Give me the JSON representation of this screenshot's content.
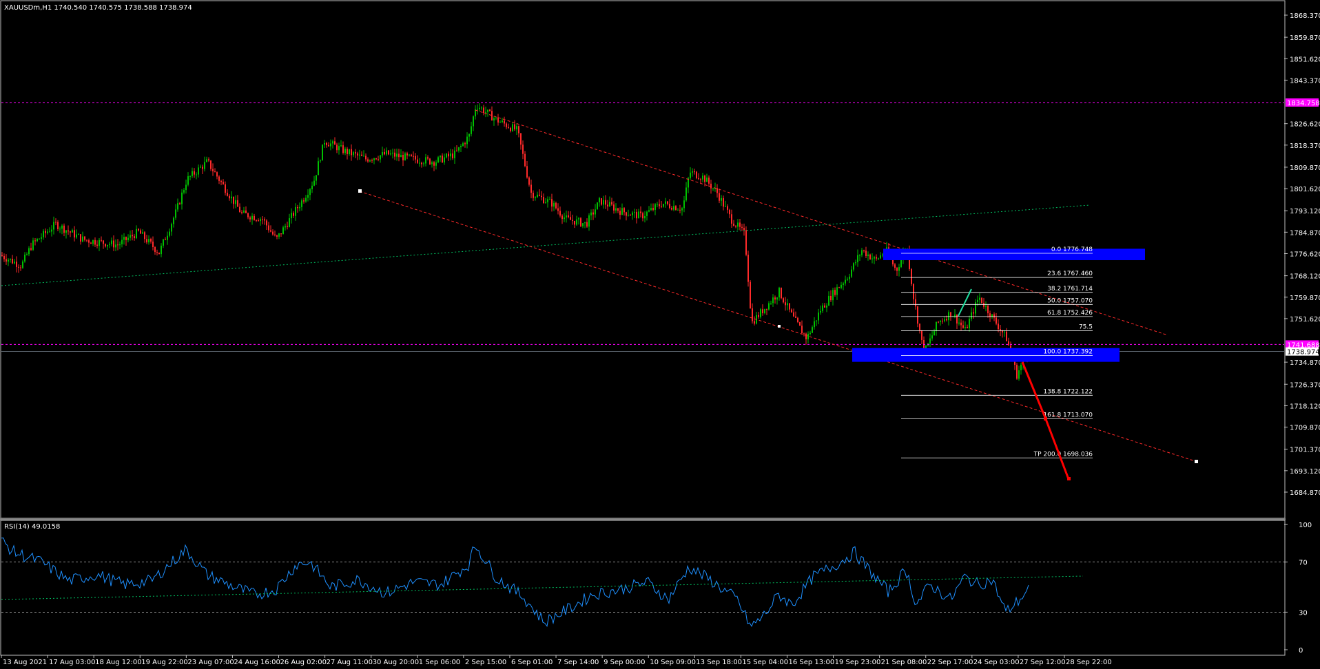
{
  "header": {
    "symbol_line": "XAUUSDm,H1  1740.540 1740.575 1738.588 1738.974",
    "rsi_line": "RSI(14) 49.0158"
  },
  "colors": {
    "bg": "#000000",
    "frame": "#c0c0c0",
    "bull": "#00c000",
    "bear": "#ff2a2a",
    "magenta": "#ff00ff",
    "channel": "#ff2a2a",
    "trend": "#00c060",
    "blue_zone": "#0000ff",
    "rsi": "#1e90ff",
    "text": "#ffffff"
  },
  "price_axis": {
    "labels": [
      "1868.370",
      "1859.870",
      "1851.620",
      "1843.370",
      "1826.620",
      "1818.370",
      "1809.870",
      "1801.620",
      "1793.120",
      "1784.870",
      "1776.620",
      "1768.120",
      "1759.870",
      "1751.620",
      "1734.870",
      "1726.370",
      "1718.120",
      "1709.870",
      "1701.370",
      "1693.120",
      "1684.870"
    ],
    "current_price": "1738.974",
    "magenta_levels": [
      "1834.758",
      "1741.688"
    ]
  },
  "rsi_axis": {
    "labels": [
      "100",
      "70",
      "30",
      "0"
    ]
  },
  "time_axis": {
    "labels": [
      "13 Aug 2021",
      "17 Aug 03:00",
      "18 Aug 12:00",
      "19 Aug 22:00",
      "23 Aug 07:00",
      "24 Aug 16:00",
      "26 Aug 02:00",
      "27 Aug 11:00",
      "30 Aug 20:00",
      "1 Sep 06:00",
      "2 Sep 15:00",
      "6 Sep 01:00",
      "7 Sep 14:00",
      "9 Sep 00:00",
      "10 Sep 09:00",
      "13 Sep 18:00",
      "15 Sep 04:00",
      "16 Sep 13:00",
      "19 Sep 23:00",
      "21 Sep 08:00",
      "22 Sep 17:00",
      "24 Sep 03:00",
      "27 Sep 12:00",
      "28 Sep 22:00"
    ]
  },
  "fibonacci": {
    "levels": [
      {
        "label": "0.0 1776.748",
        "price": 1776.748
      },
      {
        "label": "23.6 1767.460",
        "price": 1767.46
      },
      {
        "label": "38.2 1761.714",
        "price": 1761.714
      },
      {
        "label": "50.0 1757.070",
        "price": 1757.07
      },
      {
        "label": "61.8 1752.426",
        "price": 1752.426
      },
      {
        "label": "75.5",
        "price": 1747.0
      },
      {
        "label": "100.0 1737.392",
        "price": 1737.392
      },
      {
        "label": "138.8 1722.122",
        "price": 1722.122
      },
      {
        "label": "161.8 1713.070",
        "price": 1713.07
      },
      {
        "label": "TP 200.0 1698.036",
        "price": 1698.036
      }
    ]
  }
}
